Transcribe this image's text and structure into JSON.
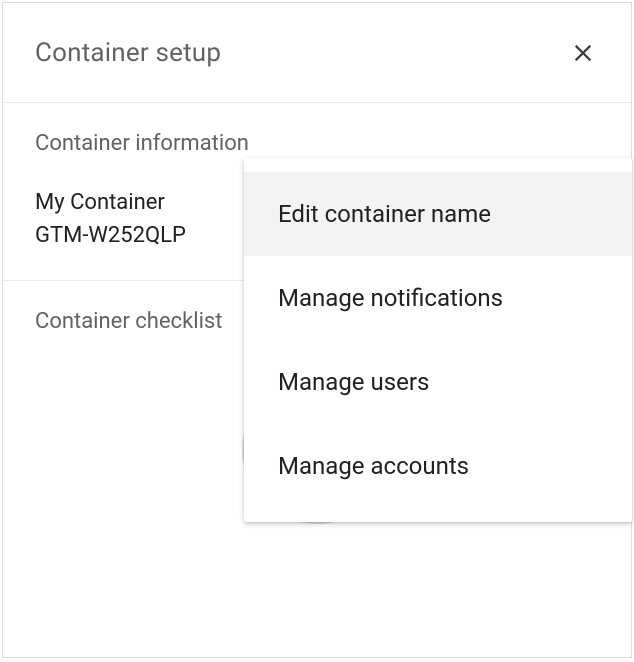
{
  "header": {
    "title": "Container setup"
  },
  "info": {
    "section_label": "Container information",
    "container_name": "My Container",
    "container_id": "GTM-W252QLP"
  },
  "checklist": {
    "section_label": "Container checklist"
  },
  "menu": {
    "items": [
      {
        "label": "Edit container name"
      },
      {
        "label": "Manage notifications"
      },
      {
        "label": "Manage users"
      },
      {
        "label": "Manage accounts"
      }
    ]
  }
}
